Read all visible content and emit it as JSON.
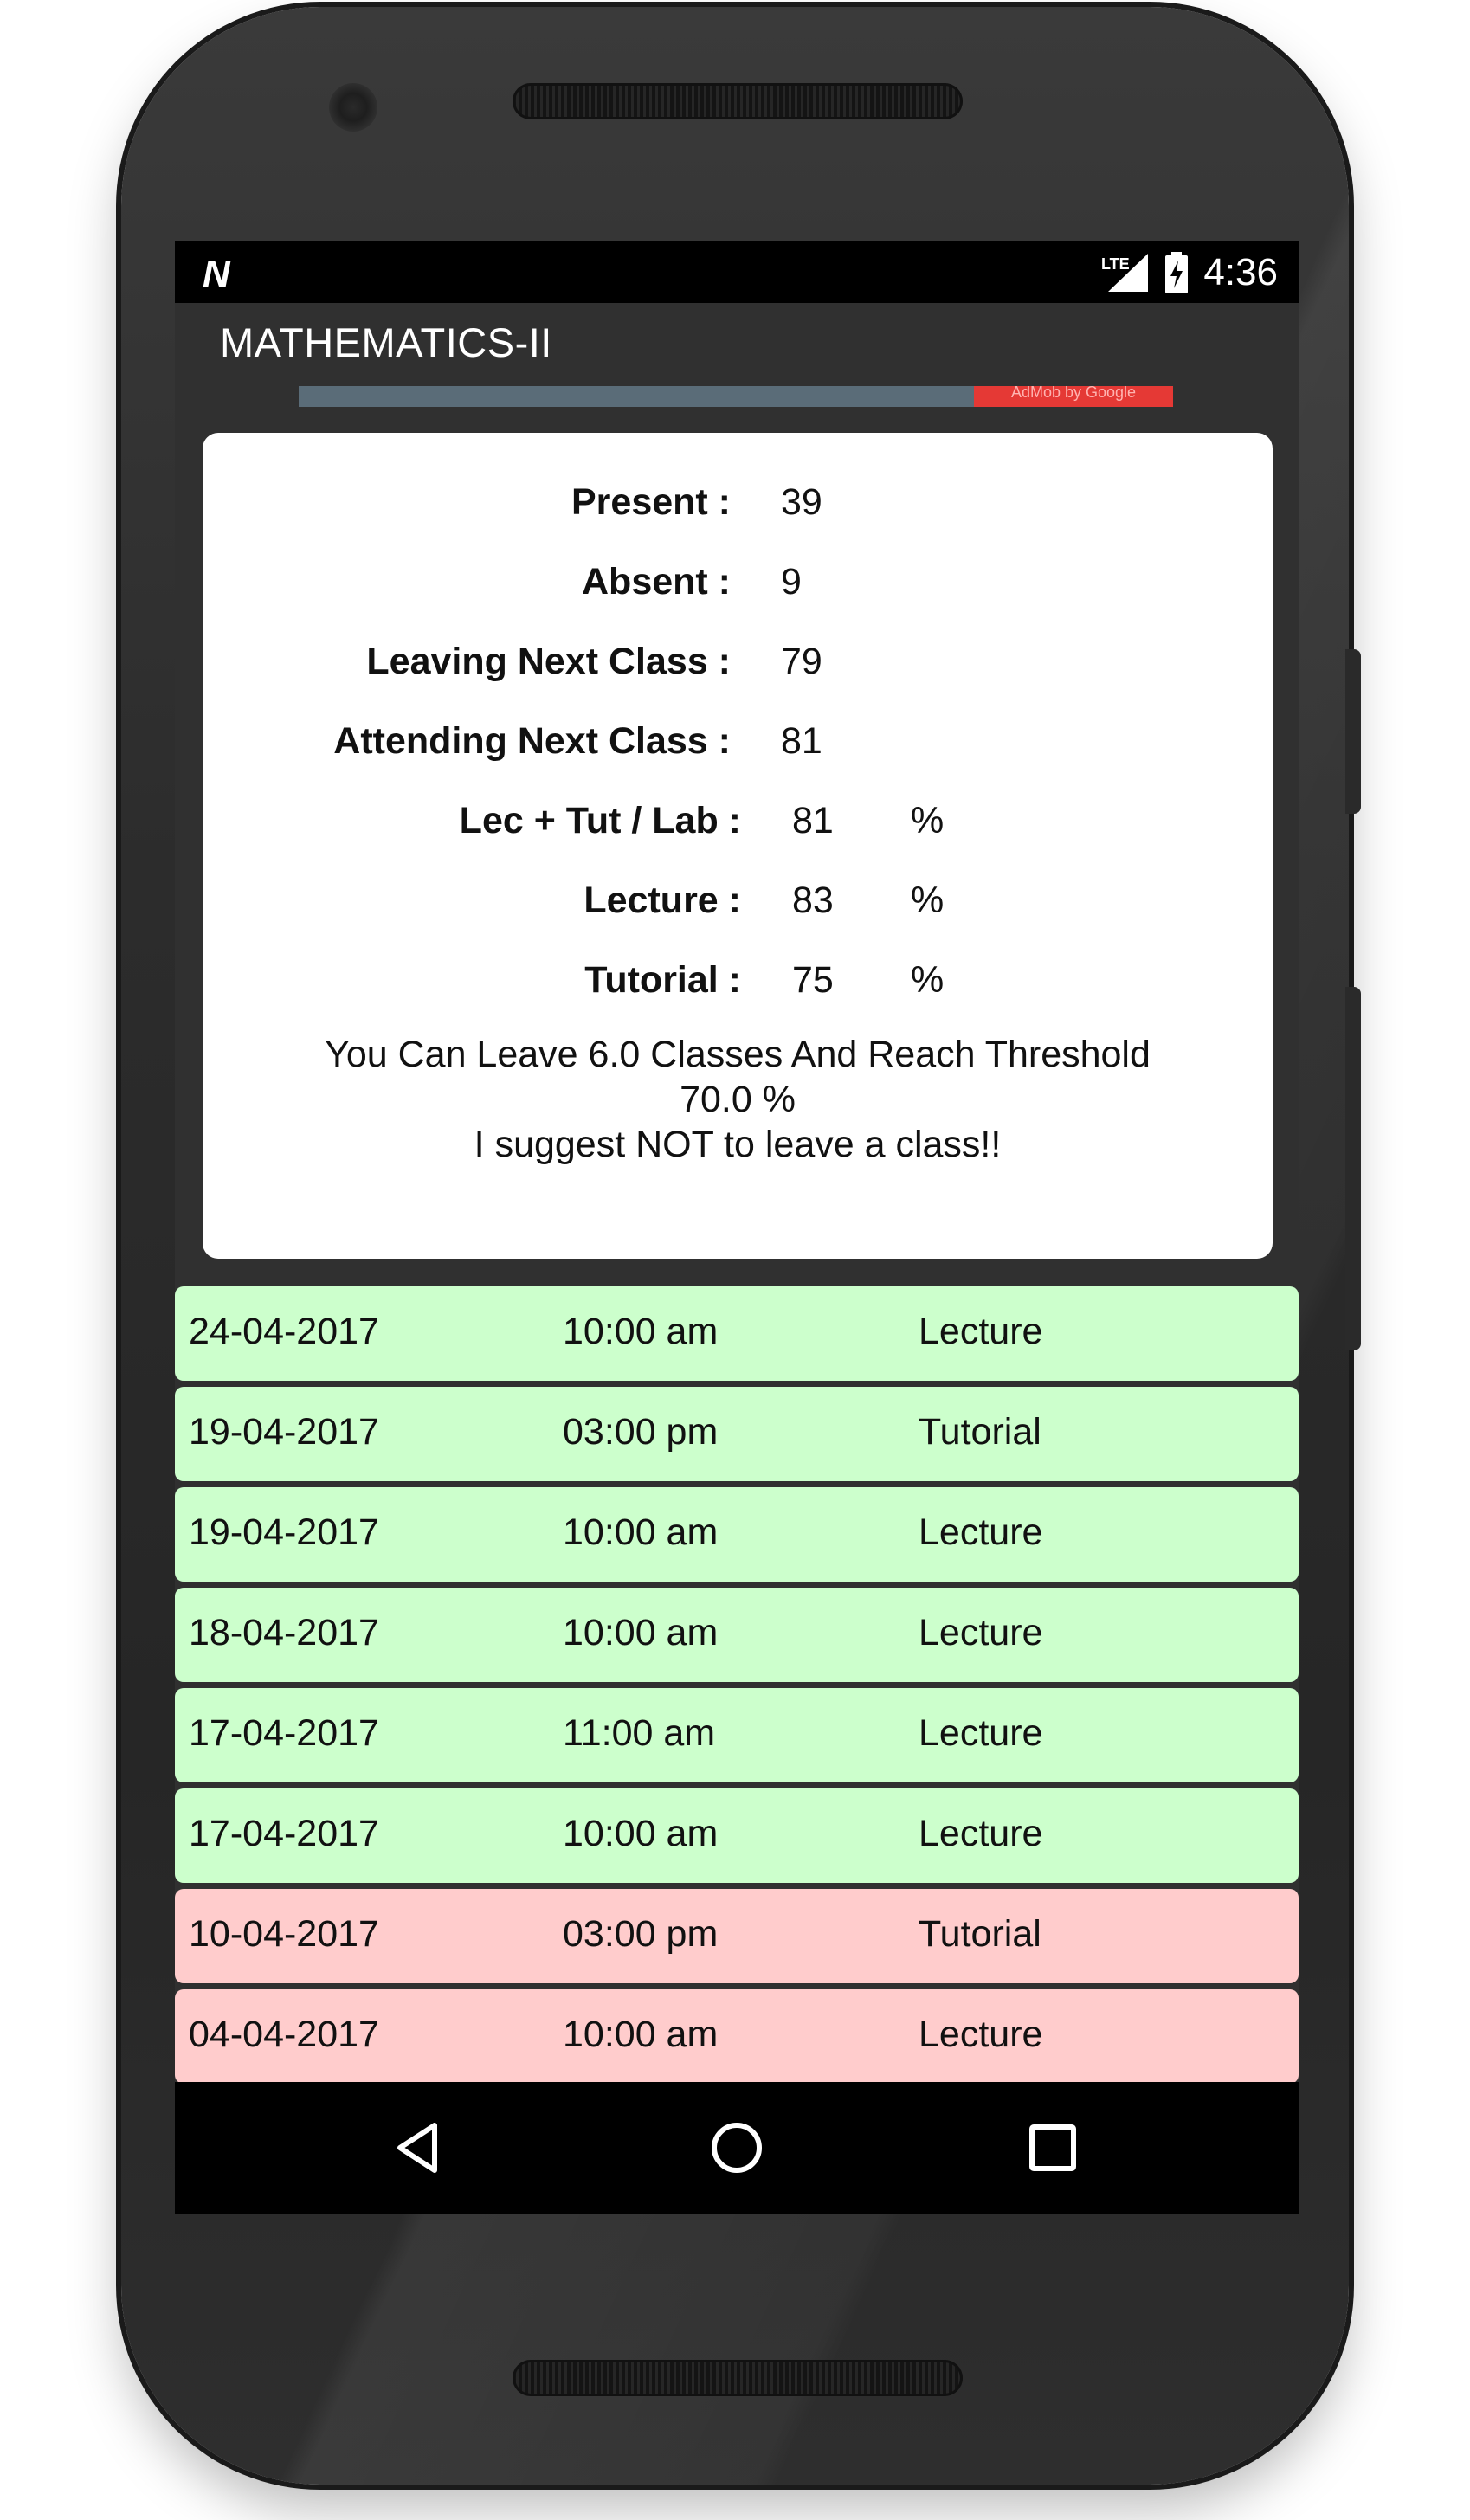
{
  "status_bar": {
    "notification_icon": "N",
    "signal_label": "LTE",
    "time": "4:36"
  },
  "app_bar": {
    "title": "MATHEMATICS-II"
  },
  "ad_banner": {
    "badge_text": "AdMob by Google"
  },
  "stats": [
    {
      "label": "Present :",
      "value": "39",
      "unit": ""
    },
    {
      "label": "Absent :",
      "value": "9",
      "unit": ""
    },
    {
      "label": "Leaving Next Class :",
      "value": "79",
      "unit": ""
    },
    {
      "label": "Attending Next Class :",
      "value": "81",
      "unit": ""
    },
    {
      "label": "Lec + Tut / Lab :",
      "value": "81",
      "unit": "%"
    },
    {
      "label": "Lecture :",
      "value": "83",
      "unit": "%"
    },
    {
      "label": "Tutorial :",
      "value": "75",
      "unit": "%"
    }
  ],
  "summary": {
    "line1": "You Can Leave 6.0 Classes And Reach Threshold",
    "line2": "70.0 %",
    "line3": "I suggest NOT to leave a class!!"
  },
  "attendance": [
    {
      "date": "24-04-2017",
      "time": "10:00 am",
      "type": "Lecture",
      "status": "present"
    },
    {
      "date": "19-04-2017",
      "time": "03:00 pm",
      "type": "Tutorial",
      "status": "present"
    },
    {
      "date": "19-04-2017",
      "time": "10:00 am",
      "type": "Lecture",
      "status": "present"
    },
    {
      "date": "18-04-2017",
      "time": "10:00 am",
      "type": "Lecture",
      "status": "present"
    },
    {
      "date": "17-04-2017",
      "time": "11:00 am",
      "type": "Lecture",
      "status": "present"
    },
    {
      "date": "17-04-2017",
      "time": "10:00 am",
      "type": "Lecture",
      "status": "present"
    },
    {
      "date": "10-04-2017",
      "time": "03:00 pm",
      "type": "Tutorial",
      "status": "absent"
    },
    {
      "date": "04-04-2017",
      "time": "10:00 am",
      "type": "Lecture",
      "status": "absent"
    }
  ],
  "nav_bar": {
    "back_icon": "back-triangle-icon",
    "home_icon": "home-circle-icon",
    "recents_icon": "recents-square-icon"
  },
  "colors": {
    "present_row": "#ccffcc",
    "absent_row": "#ffcccc",
    "app_bar": "#303030",
    "ad_badge": "#e53935"
  }
}
